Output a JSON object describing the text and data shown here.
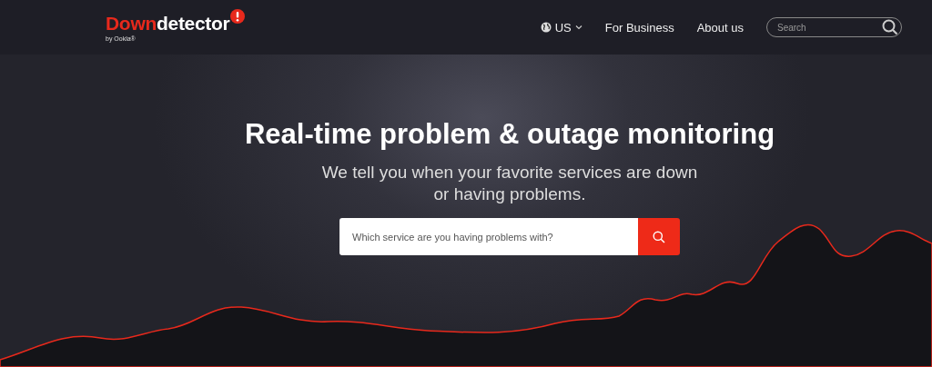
{
  "header": {
    "logo": {
      "parts": [
        "Down",
        "detector"
      ],
      "byline": "by Ookla®"
    },
    "nav": [
      {
        "kind": "region",
        "label": "US"
      },
      {
        "kind": "link",
        "label": "For Business"
      },
      {
        "kind": "link",
        "label": "About us"
      }
    ],
    "search": {
      "placeholder": "Search"
    }
  },
  "hero": {
    "title": "Real-time problem & outage monitoring",
    "subtitle_lines": [
      "We tell you when your favorite services are down",
      "or having problems."
    ],
    "search": {
      "placeholder": "Which service are you having problems with?"
    }
  }
}
